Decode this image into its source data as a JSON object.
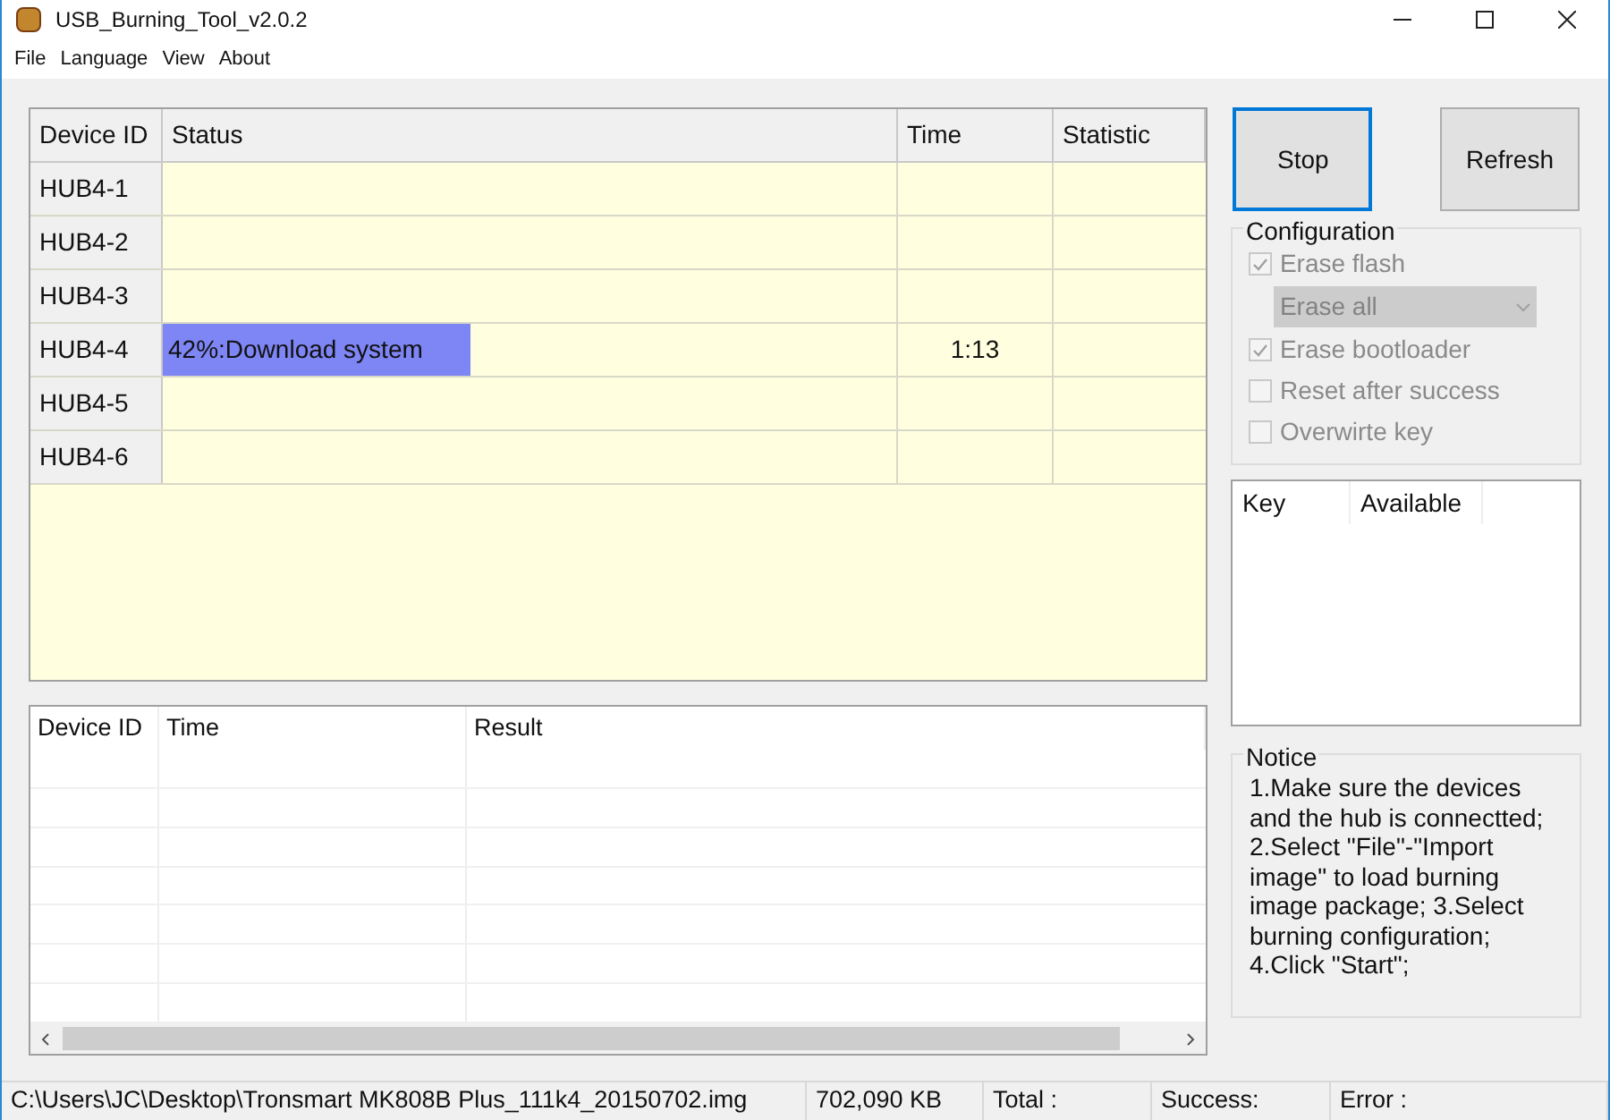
{
  "window": {
    "title": "USB_Burning_Tool_v2.0.2"
  },
  "menu": [
    "File",
    "Language",
    "View",
    "About"
  ],
  "device_table": {
    "columns": [
      "Device ID",
      "Status",
      "Time",
      "Statistic"
    ],
    "rows": [
      {
        "device": "HUB4-1"
      },
      {
        "device": "HUB4-2"
      },
      {
        "device": "HUB4-3"
      },
      {
        "device": "HUB4-4",
        "status": "42%:Download system",
        "level": 0.42,
        "time": "1:13"
      },
      {
        "device": "HUB4-5"
      },
      {
        "device": "HUB4-6"
      }
    ]
  },
  "result_table": {
    "columns": [
      "Device ID",
      "Time",
      "Result"
    ]
  },
  "buttons": [
    "Stop",
    "Refresh"
  ],
  "configuration": {
    "title": "Configuration",
    "items": [
      {
        "kind": "checkbox",
        "label": "Erase flash",
        "checked": true,
        "disabled": true
      },
      {
        "kind": "dropdown",
        "label": "Erase all",
        "disabled": true
      },
      {
        "kind": "checkbox",
        "label": "Erase bootloader",
        "checked": true,
        "disabled": true
      },
      {
        "kind": "checkbox",
        "label": "Reset after success",
        "checked": false,
        "disabled": true
      },
      {
        "kind": "checkbox",
        "label": "Overwirte key",
        "checked": false,
        "disabled": true
      }
    ]
  },
  "key_table": {
    "columns": [
      "Key",
      "Available"
    ]
  },
  "notice": {
    "title": "Notice",
    "text": "1.Make sure the devices and the hub is connectted; 2.Select \"File\"-\"Import image\" to load burning image package; 3.Select burning configuration; 4.Click \"Start\";"
  },
  "status_bar": [
    "C:\\Users\\JC\\Desktop\\Tronsmart MK808B Plus_111k4_20150702.img",
    "702,090 KB",
    "Total :",
    "Success:",
    "Error :"
  ]
}
